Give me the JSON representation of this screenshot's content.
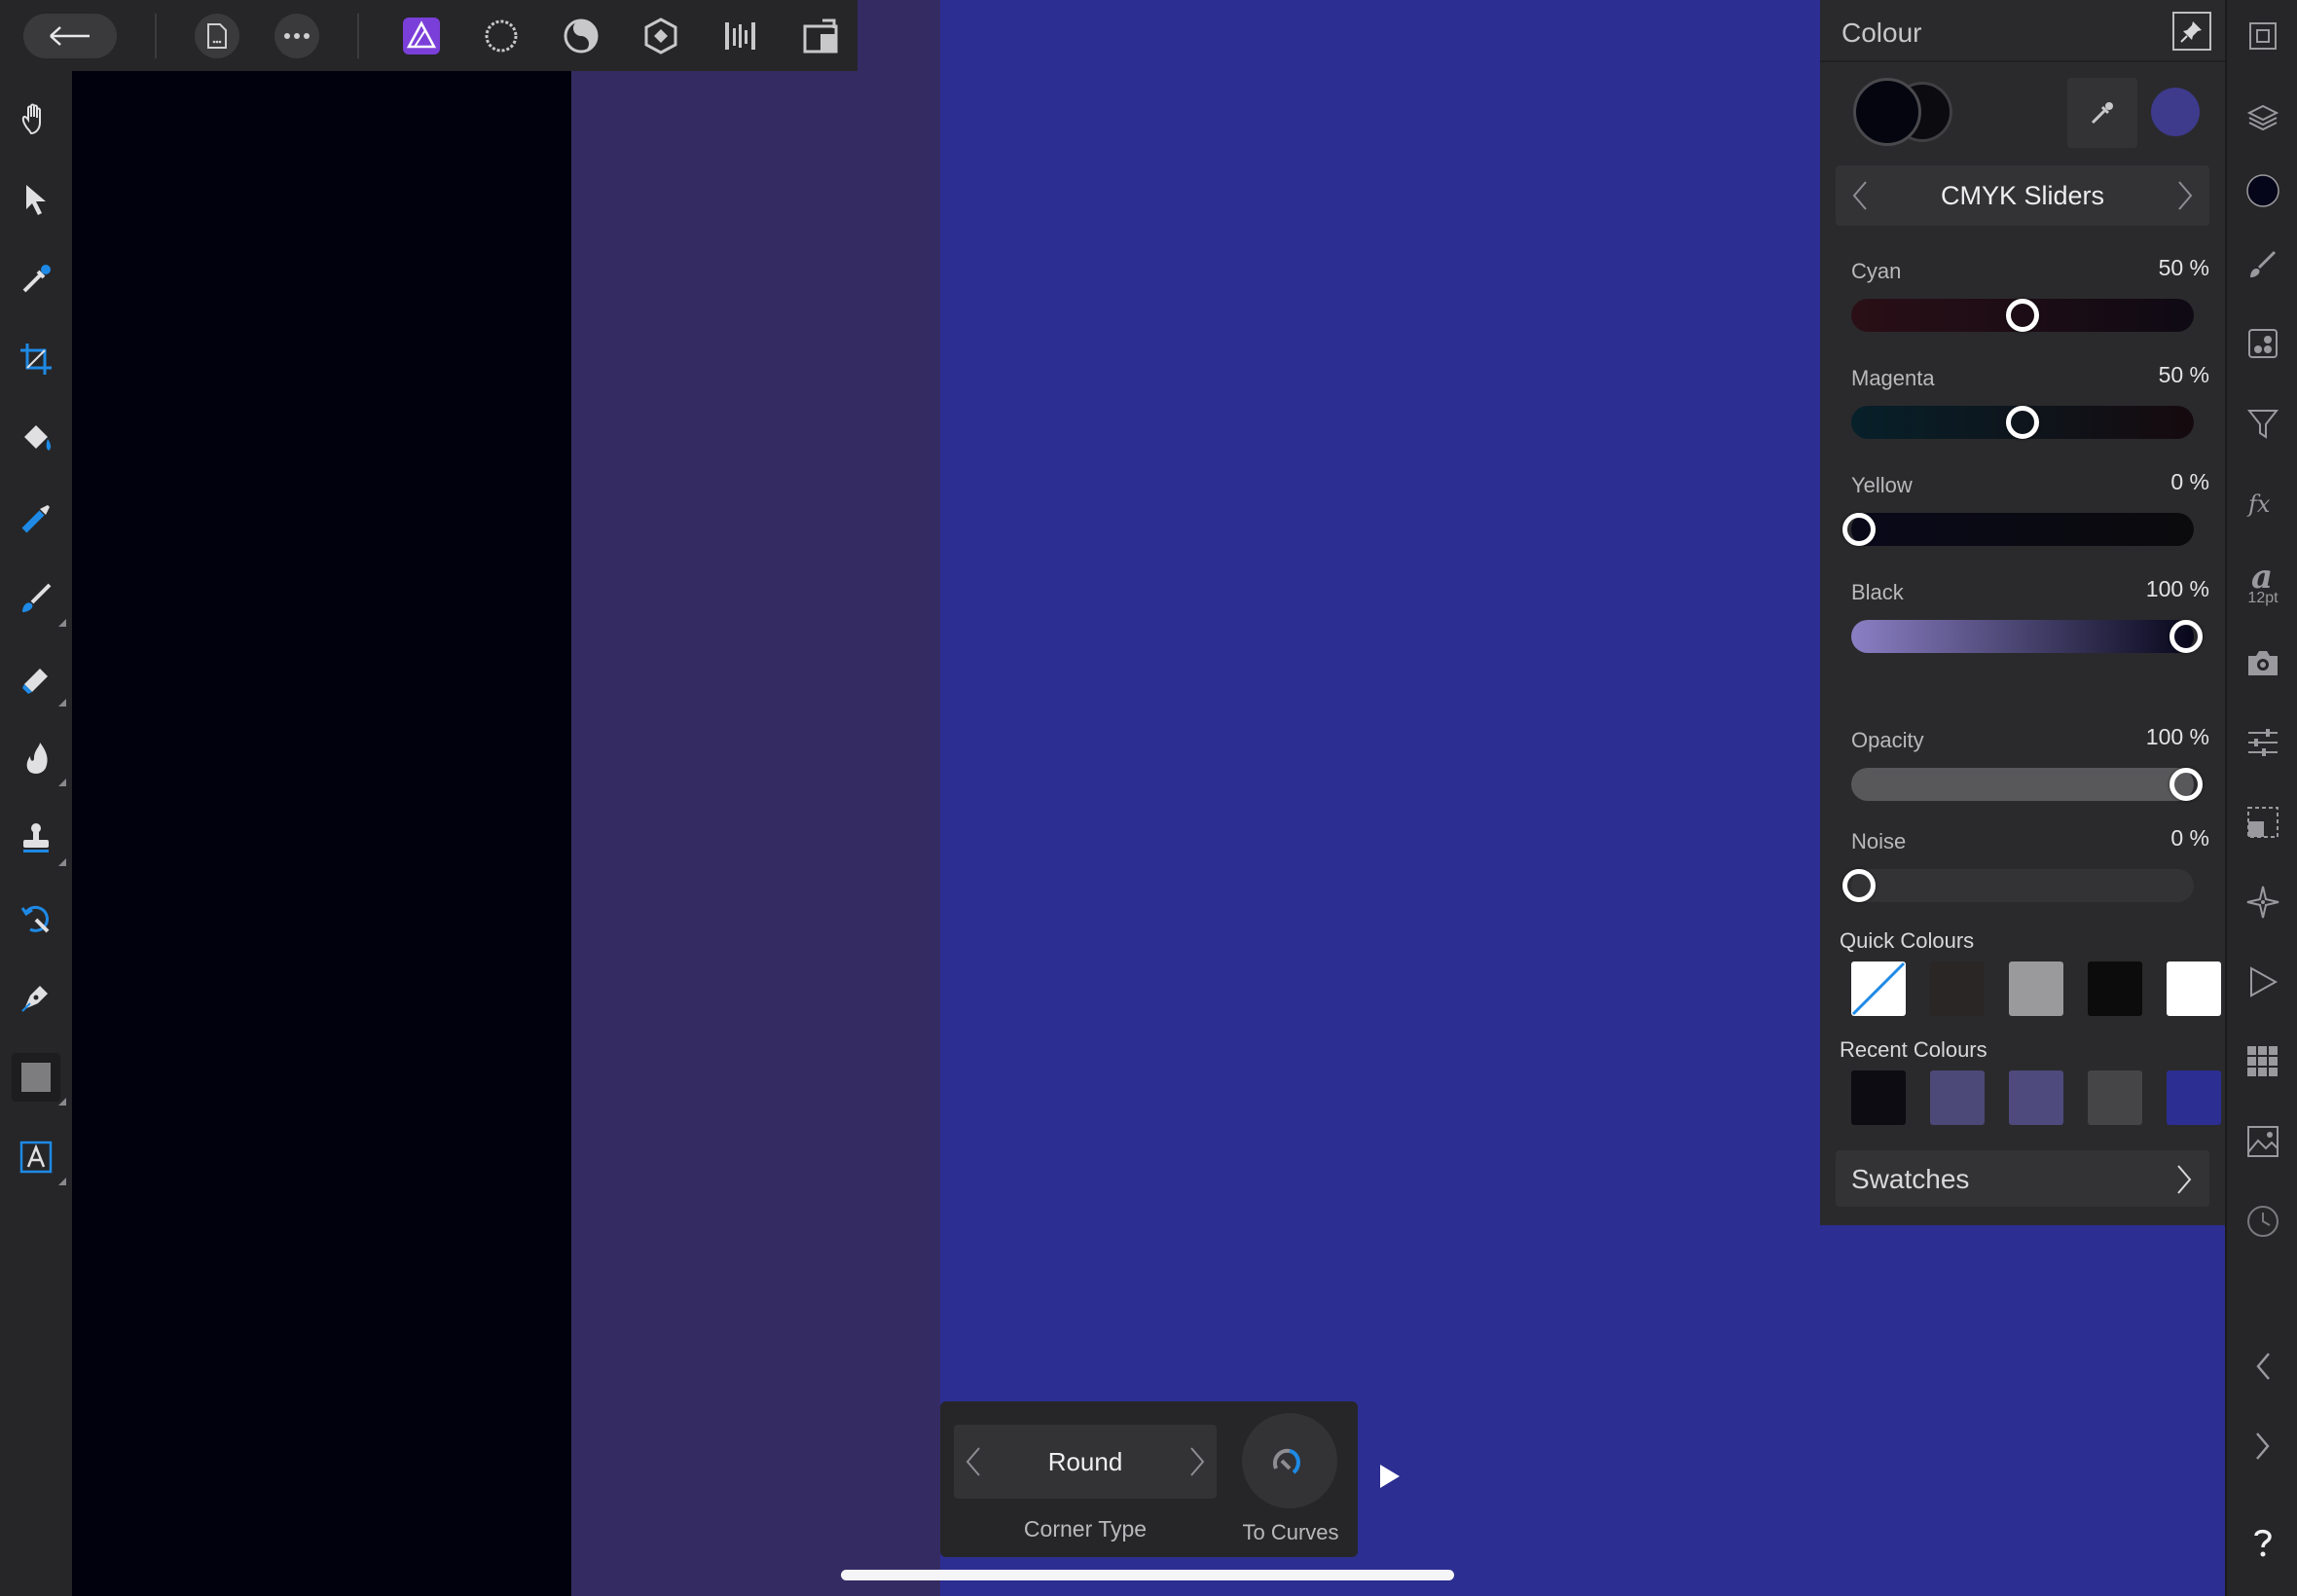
{
  "panel": {
    "title": "Colour",
    "mode_label": "CMYK Sliders",
    "sliders": [
      {
        "label": "Cyan",
        "value": "50 %",
        "level": 0.5
      },
      {
        "label": "Magenta",
        "value": "50 %",
        "level": 0.5
      },
      {
        "label": "Yellow",
        "value": "0 %",
        "level": 0
      },
      {
        "label": "Black",
        "value": "100 %",
        "level": 1
      },
      {
        "label": "Opacity",
        "value": "100 %",
        "level": 1
      },
      {
        "label": "Noise",
        "value": "0 %",
        "level": 0
      }
    ],
    "quick_colours_label": "Quick Colours",
    "quick_colours": [
      "none",
      "#2a2626",
      "#9a9a9c",
      "#0c0c0c",
      "#ffffff"
    ],
    "recent_colours_label": "Recent Colours",
    "recent_colours": [
      "#0d0c12",
      "#4c4877",
      "#4e4a7d",
      "#454547",
      "#2c2e92"
    ],
    "swatches_label": "Swatches",
    "current_colour": "#3e3a8c"
  },
  "context": {
    "corner_type_value": "Round",
    "corner_type_label": "Corner Type",
    "to_curves_label": "To Curves"
  },
  "studio": {
    "character_size": "12pt"
  },
  "colors": {
    "canvas_blue": "#2c2e92",
    "canvas_purple": "#352b63",
    "accent_blue": "#1e8ae6",
    "persona_purple": "#7b3fd9"
  },
  "toolbar": {
    "tools": [
      "view-tool-icon",
      "move-tool-icon",
      "colour-picker-tool-icon",
      "crop-tool-icon",
      "flood-fill-tool-icon",
      "selection-brush-tool-icon",
      "paint-brush-tool-icon",
      "erase-brush-tool-icon",
      "burn-brush-tool-icon",
      "clone-brush-tool-icon",
      "undo-brush-tool-icon",
      "pen-tool-icon",
      "rectangle-tool-icon",
      "text-tool-icon"
    ]
  }
}
